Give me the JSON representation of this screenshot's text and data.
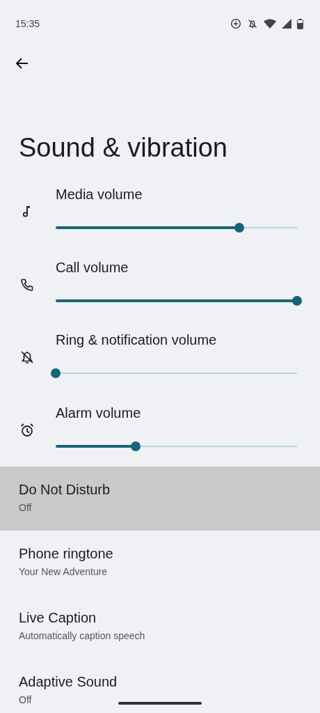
{
  "status_bar": {
    "time": "15:35"
  },
  "title": "Sound & vibration",
  "volumes": [
    {
      "label": "Media volume",
      "level": 0.76
    },
    {
      "label": "Call volume",
      "level": 1
    },
    {
      "label": "Ring & notification volume",
      "level": 0
    },
    {
      "label": "Alarm volume",
      "level": 0.33
    }
  ],
  "items": [
    {
      "title": "Do Not Disturb",
      "summary": "Off",
      "selected": true
    },
    {
      "title": "Phone ringtone",
      "summary": "Your New Adventure",
      "selected": false
    },
    {
      "title": "Live Caption",
      "summary": "Automatically caption speech",
      "selected": false
    },
    {
      "title": "Adaptive Sound",
      "summary": "Off",
      "selected": false
    }
  ]
}
